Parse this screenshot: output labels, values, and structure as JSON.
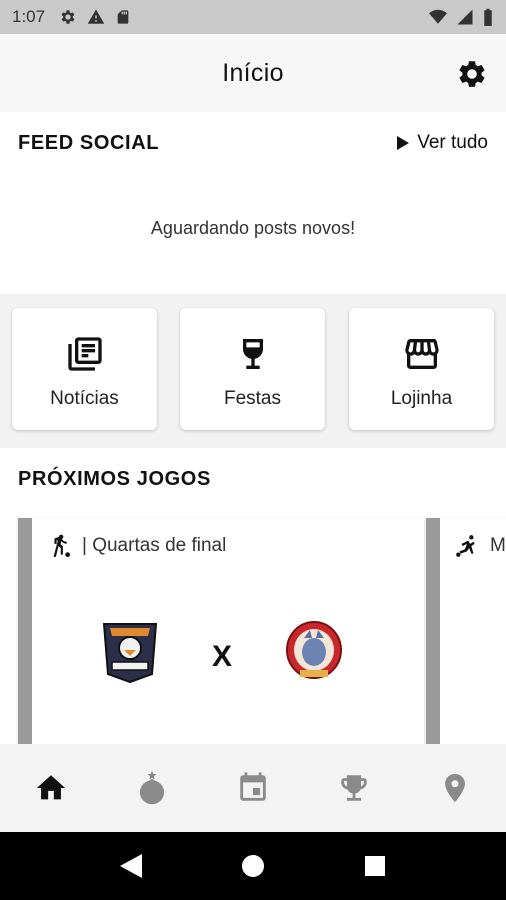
{
  "status_bar": {
    "time": "1:07",
    "left_icons": [
      "settings-icon",
      "alert-icon",
      "sd-card-icon"
    ],
    "right_icons": [
      "wifi-icon",
      "signal-icon",
      "battery-icon"
    ]
  },
  "app_bar": {
    "title": "Início",
    "settings_icon": "gear-icon"
  },
  "feed_social": {
    "heading": "FEED SOCIAL",
    "see_all": "Ver tudo",
    "empty_message": "Aguardando posts novos!"
  },
  "shortcuts": [
    {
      "label": "Notícias",
      "icon": "newspaper-icon"
    },
    {
      "label": "Festas",
      "icon": "wine-glass-icon"
    },
    {
      "label": "Lojinha",
      "icon": "store-icon"
    }
  ],
  "upcoming_games": {
    "heading": "PRÓXIMOS JOGOS",
    "matches": [
      {
        "phase": "| Quartas de final",
        "sport_icon": "soccer-player-icon",
        "separator": "X",
        "home_crest": "crest-eagle",
        "away_crest": "crest-monster"
      },
      {
        "phase": "M",
        "sport_icon": "soccer-kick-icon"
      }
    ]
  },
  "bottom_nav": [
    {
      "name": "home",
      "icon": "home-icon",
      "active": true
    },
    {
      "name": "bomb",
      "icon": "bomb-icon",
      "active": false
    },
    {
      "name": "calendar",
      "icon": "calendar-icon",
      "active": false
    },
    {
      "name": "trophy",
      "icon": "trophy-icon",
      "active": false
    },
    {
      "name": "location",
      "icon": "location-pin-icon",
      "active": false
    }
  ],
  "colors": {
    "active_nav": "#111111",
    "inactive_nav": "#8a8a8a",
    "accent_bar": "#9a9a9a"
  }
}
